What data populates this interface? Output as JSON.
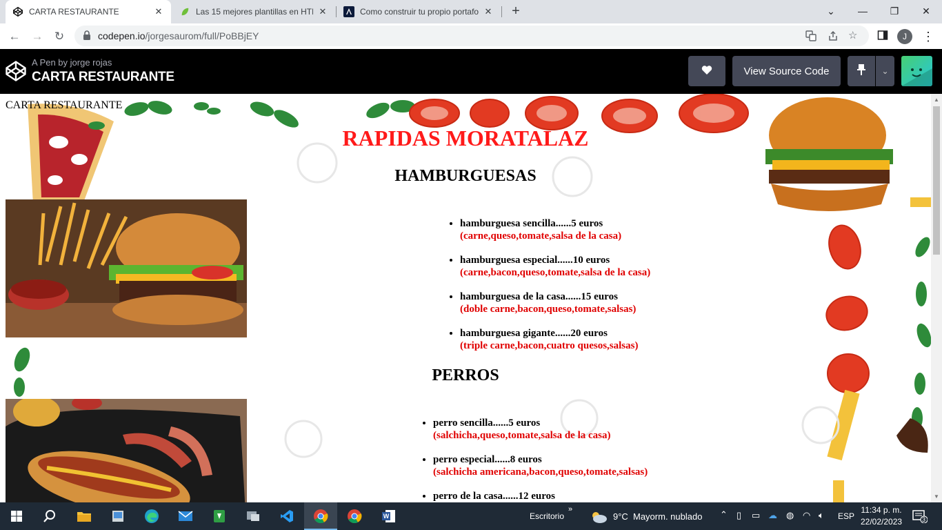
{
  "browser": {
    "tabs": [
      {
        "title": "CARTA RESTAURANTE",
        "icon": "codepen-icon",
        "active": true
      },
      {
        "title": "Las 15 mejores plantillas en HTM",
        "icon": "leaf-icon",
        "active": false
      },
      {
        "title": "Como construir tu propio portafo",
        "icon": "angular-icon",
        "active": false
      }
    ],
    "url_host": "codepen.io",
    "url_path": "/jorgesaurom/full/PoBBjEY",
    "profile_initial": "J"
  },
  "codepen": {
    "byline": "A Pen by jorge rojas",
    "title": "CARTA RESTAURANTE",
    "view_source_label": "View Source Code"
  },
  "page": {
    "doc_title": "CARTA RESTAURANTE",
    "heading": "RAPIDAS MORATALAZ",
    "sections": [
      {
        "title": "HAMBURGUESAS",
        "items": [
          {
            "name": "hamburguesa sencilla......5 euros",
            "desc": "(carne,queso,tomate,salsa de la casa)"
          },
          {
            "name": "hamburguesa especial......10 euros",
            "desc": "(carne,bacon,queso,tomate,salsa de la casa)"
          },
          {
            "name": "hamburguesa de la casa......15 euros",
            "desc": "(doble carne,bacon,queso,tomate,salsas)"
          },
          {
            "name": "hamburguesa gigante......20 euros",
            "desc": "(triple carne,bacon,cuatro quesos,salsas)"
          }
        ]
      },
      {
        "title": "PERROS",
        "items": [
          {
            "name": "perro sencilla......5 euros",
            "desc": "(salchicha,queso,tomate,salsa de la casa)"
          },
          {
            "name": "perro especial......8 euros",
            "desc": "(salchicha americana,bacon,queso,tomate,salsas)"
          },
          {
            "name": "perro de la casa......12 euros",
            "desc": ""
          }
        ]
      }
    ],
    "accent_color": "#ff1a1a"
  },
  "taskbar": {
    "desktop_label": "Escritorio",
    "weather_temp": "9°C",
    "weather_text": "Mayorm. nublado",
    "lang": "ESP",
    "time": "11:34 p. m.",
    "date": "22/02/2023",
    "notifications": "3"
  }
}
